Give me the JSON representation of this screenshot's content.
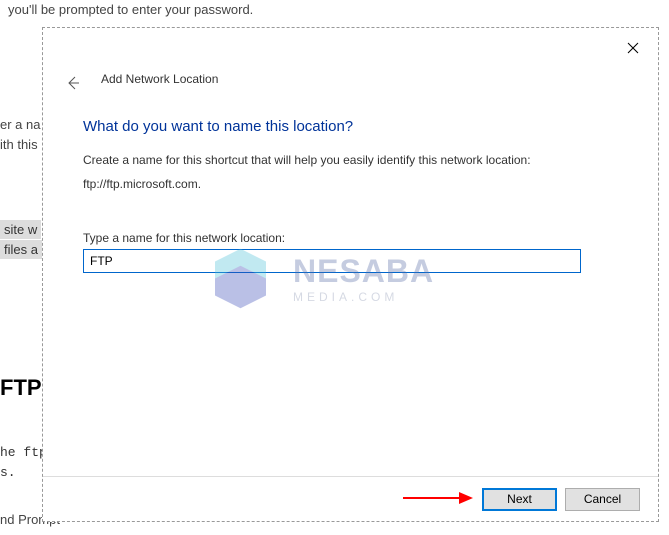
{
  "background": {
    "line1": "you'll be prompted to enter your password.",
    "line2a": "er a na",
    "line2b": "ith this",
    "grey1": "site w",
    "grey2": "files a",
    "heading": "FTP",
    "code1": "he ftp",
    "code2": "s.",
    "bottom": "nd Prompt"
  },
  "dialog": {
    "title": "Add Network Location",
    "heading": "What do you want to name this location?",
    "description": "Create a name for this shortcut that will help you easily identify this network location:",
    "url": "ftp://ftp.microsoft.com.",
    "input_label": "Type a name for this network location:",
    "input_value": "FTP",
    "next_label": "Next",
    "cancel_label": "Cancel"
  },
  "watermark": {
    "brand": "NESABA",
    "sub": "MEDIA.COM"
  }
}
